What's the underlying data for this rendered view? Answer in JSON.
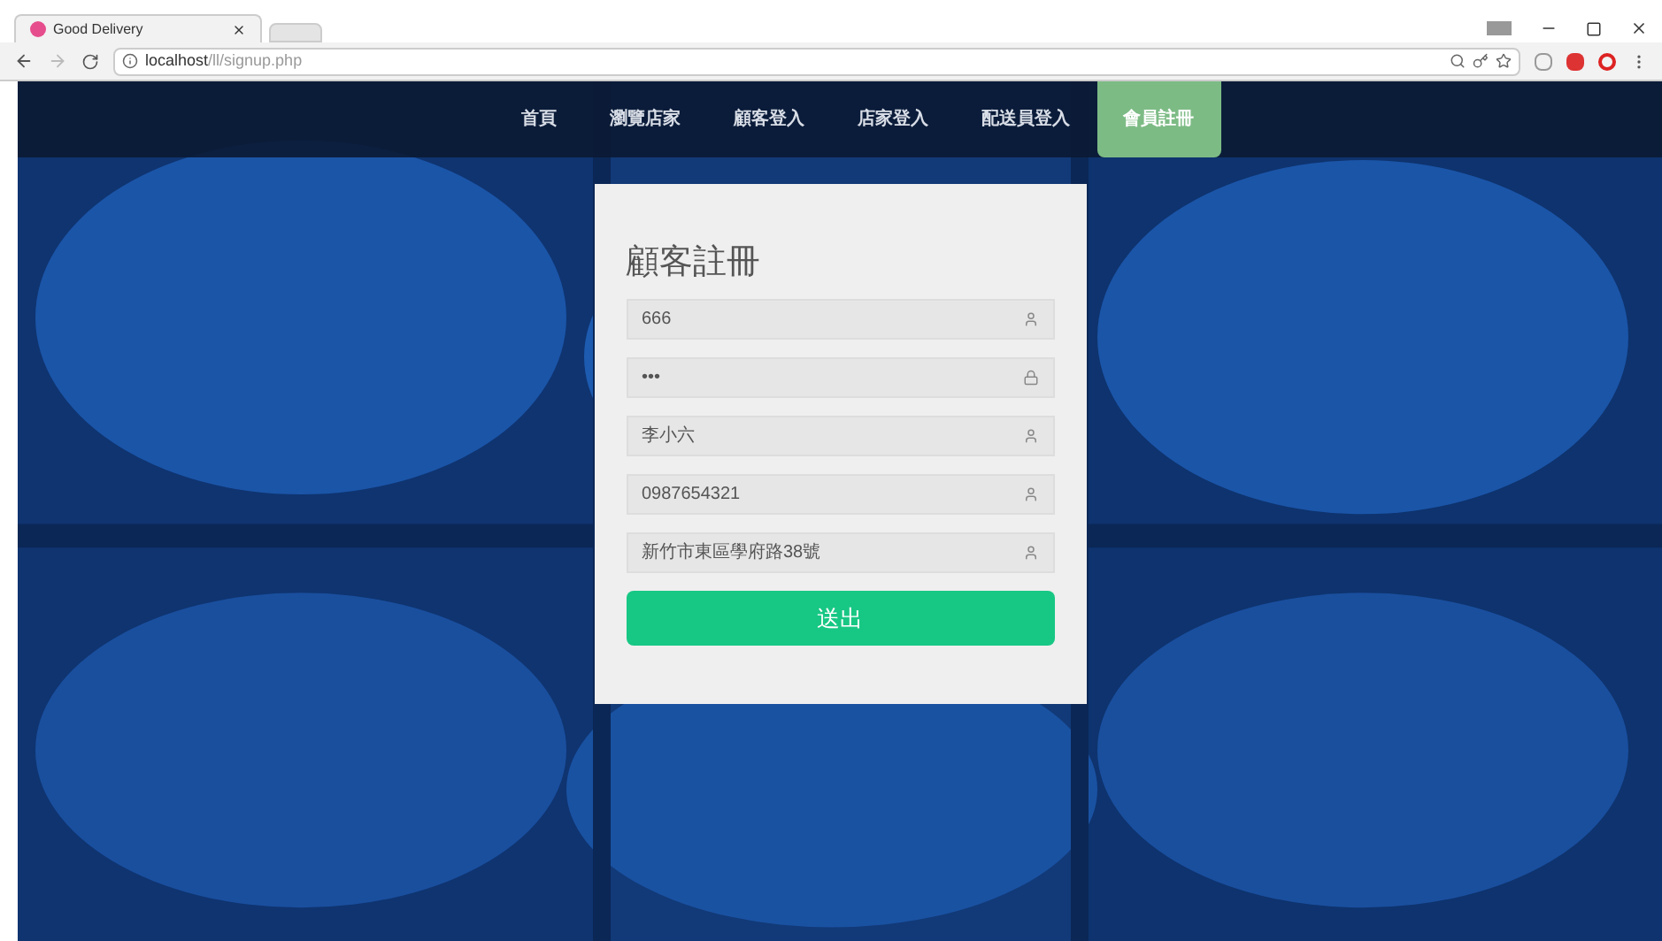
{
  "browser": {
    "tab_title": "Good Delivery",
    "url_host": "localhost",
    "url_path": "/ll/signup.php"
  },
  "nav": [
    {
      "label": "首頁",
      "selected": false
    },
    {
      "label": "瀏覽店家",
      "selected": false
    },
    {
      "label": "顧客登入",
      "selected": false
    },
    {
      "label": "店家登入",
      "selected": false
    },
    {
      "label": "配送員登入",
      "selected": false
    },
    {
      "label": "會員註冊",
      "selected": true
    }
  ],
  "form": {
    "title": "顧客註冊",
    "fields": [
      {
        "value": "666",
        "kind": "user"
      },
      {
        "value": "•••",
        "kind": "lock"
      },
      {
        "value": "李小六",
        "kind": "user"
      },
      {
        "value": "0987654321",
        "kind": "user"
      },
      {
        "value": "新竹市東區學府路38號",
        "kind": "user"
      }
    ],
    "submit": "送出"
  }
}
